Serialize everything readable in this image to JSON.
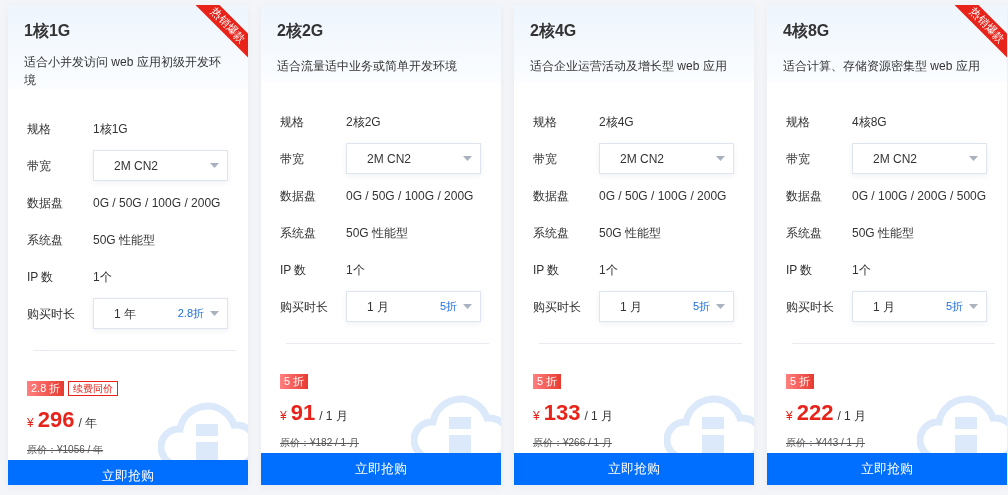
{
  "plans": [
    {
      "title": "1核1G",
      "description": "适合小并发访问 web 应用初级开发环境",
      "ribbon": "热销爆款",
      "specs": [
        {
          "kind": "text",
          "label": "规格",
          "value": "1核1G"
        },
        {
          "kind": "select",
          "label": "带宽",
          "value": "2M CN2"
        },
        {
          "kind": "text",
          "label": "数据盘",
          "value": "0G / 50G / 100G / 200G"
        },
        {
          "kind": "text",
          "label": "系统盘",
          "value": "50G 性能型"
        },
        {
          "kind": "text",
          "label": "IP 数",
          "value": "1个"
        },
        {
          "kind": "select",
          "label": "购买时长",
          "value": "1 年",
          "note": "2.8折"
        }
      ],
      "discount": "2.8 折",
      "tag": "续费同价",
      "currency": "¥",
      "price": "296",
      "unit": "/ 年",
      "original": "原价：¥1056 / 年",
      "button": "立即抢购"
    },
    {
      "title": "2核2G",
      "description": "适合流量适中业务或简单开发环境",
      "specs": [
        {
          "kind": "text",
          "label": "规格",
          "value": "2核2G"
        },
        {
          "kind": "select",
          "label": "带宽",
          "value": "2M CN2"
        },
        {
          "kind": "text",
          "label": "数据盘",
          "value": "0G / 50G / 100G / 200G"
        },
        {
          "kind": "text",
          "label": "系统盘",
          "value": "50G 性能型"
        },
        {
          "kind": "text",
          "label": "IP 数",
          "value": "1个"
        },
        {
          "kind": "select",
          "label": "购买时长",
          "value": "1 月",
          "note": "5折"
        }
      ],
      "discount": "5 折",
      "currency": "¥",
      "price": "91",
      "unit": "/ 1 月",
      "original": "原价：¥182 / 1 月",
      "button": "立即抢购"
    },
    {
      "title": "2核4G",
      "description": "适合企业运营活动及增长型 web 应用",
      "specs": [
        {
          "kind": "text",
          "label": "规格",
          "value": "2核4G"
        },
        {
          "kind": "select",
          "label": "带宽",
          "value": "2M CN2"
        },
        {
          "kind": "text",
          "label": "数据盘",
          "value": "0G / 50G / 100G / 200G"
        },
        {
          "kind": "text",
          "label": "系统盘",
          "value": "50G 性能型"
        },
        {
          "kind": "text",
          "label": "IP 数",
          "value": "1个"
        },
        {
          "kind": "select",
          "label": "购买时长",
          "value": "1 月",
          "note": "5折"
        }
      ],
      "discount": "5 折",
      "currency": "¥",
      "price": "133",
      "unit": "/ 1 月",
      "original": "原价：¥266 / 1 月",
      "button": "立即抢购"
    },
    {
      "title": "4核8G",
      "description": "适合计算、存储资源密集型 web 应用",
      "ribbon": "热销爆款",
      "specs": [
        {
          "kind": "text",
          "label": "规格",
          "value": "4核8G"
        },
        {
          "kind": "select",
          "label": "带宽",
          "value": "2M CN2"
        },
        {
          "kind": "text",
          "label": "数据盘",
          "value": "0G / 100G / 200G / 500G"
        },
        {
          "kind": "text",
          "label": "系统盘",
          "value": "50G 性能型"
        },
        {
          "kind": "text",
          "label": "IP 数",
          "value": "1个"
        },
        {
          "kind": "select",
          "label": "购买时长",
          "value": "1 月",
          "note": "5折"
        }
      ],
      "discount": "5 折",
      "currency": "¥",
      "price": "222",
      "unit": "/ 1 月",
      "original": "原价：¥443 / 1 月",
      "button": "立即抢购"
    }
  ]
}
